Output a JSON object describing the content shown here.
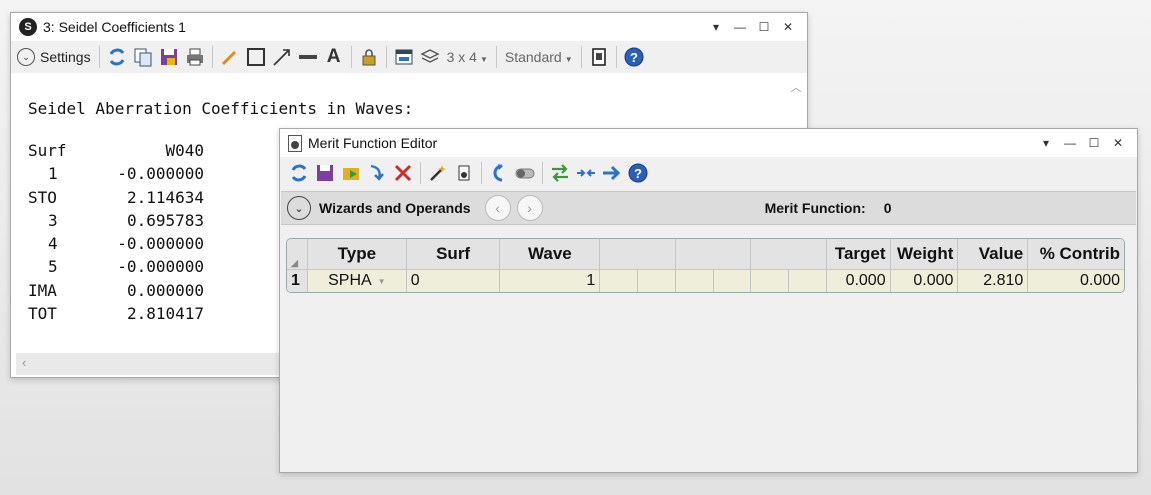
{
  "seidel": {
    "title": "3: Seidel Coefficients 1",
    "settings_label": "Settings",
    "layout_label": "3 x 4",
    "style_label": "Standard",
    "heading": "Seidel Aberration Coefficients in Waves:",
    "col_surf": "Surf",
    "col_w040": "W040",
    "rows": [
      {
        "surf": "1",
        "value": "-0.000000"
      },
      {
        "surf": "STO",
        "value": "2.114634"
      },
      {
        "surf": "3",
        "value": "0.695783"
      },
      {
        "surf": "4",
        "value": "-0.000000"
      },
      {
        "surf": "5",
        "value": "-0.000000"
      },
      {
        "surf": "IMA",
        "value": "0.000000"
      },
      {
        "surf": "TOT",
        "value": "2.810417"
      }
    ]
  },
  "merit": {
    "title": "Merit Function Editor",
    "wizards_label": "Wizards and Operands",
    "merit_label": "Merit Function:",
    "merit_value": "0",
    "headers": {
      "type": "Type",
      "surf": "Surf",
      "wave": "Wave",
      "target": "Target",
      "weight": "Weight",
      "value": "Value",
      "contrib": "% Contrib"
    },
    "row": {
      "num": "1",
      "type": "SPHA",
      "surf": "0",
      "wave": "1",
      "target": "0.000",
      "weight": "0.000",
      "value": "2.810",
      "contrib": "0.000"
    }
  },
  "colors": {
    "accent_blue": "#2b72c9",
    "row_highlight": "#efeeda"
  }
}
